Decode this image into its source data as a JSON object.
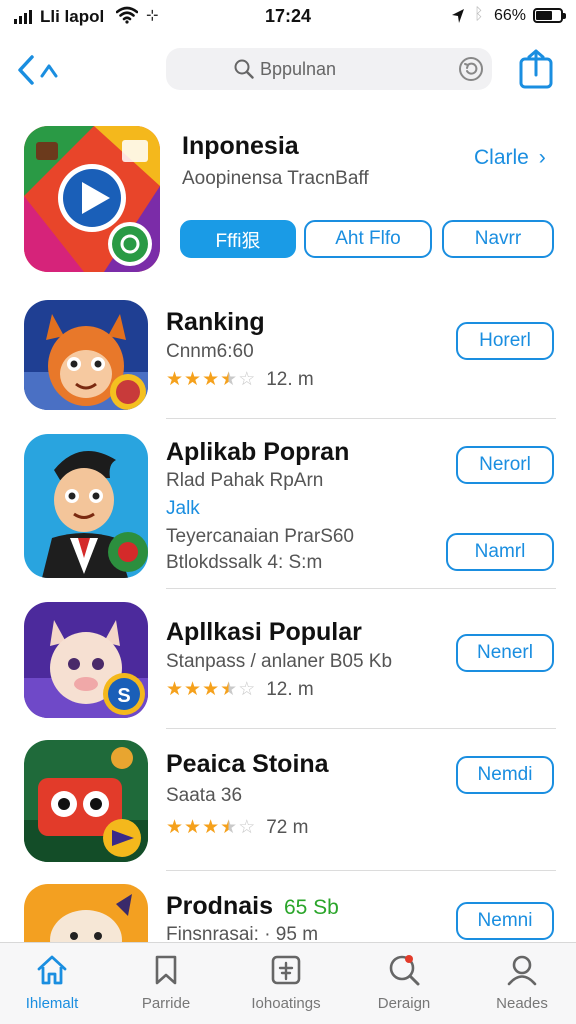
{
  "status_bar": {
    "carrier": "Lli lapol",
    "glyph": "⊹",
    "time": "17:24",
    "battery_pct": "66%",
    "battery_level": 0.66
  },
  "nav": {
    "search_placeholder": "Bppulnan"
  },
  "featured": {
    "title": "Inponesia",
    "subtitle": "Aoopinensa TracnBaff",
    "side_link": "Clarle",
    "buttons": [
      "Fffi狠",
      "Aht Flfo",
      "Navrr"
    ]
  },
  "apps": [
    {
      "title": "Ranking",
      "line1": "Cnnm6:60",
      "rating": 3.5,
      "count": "12. m",
      "button": "Horerl"
    },
    {
      "title": "Aplikab Popran",
      "line1": "Rlad Pahak RpArn",
      "blue": "Jalk",
      "line2": "Teyercanaian PrarS60",
      "line3": "Btlokdssalk 4: S:m",
      "button": "Nerorl",
      "button2": "Namrl"
    },
    {
      "title": "Apllkasi Popular",
      "line1": "Stanpass / anlaner B05 Kb",
      "rating": 3.5,
      "count": "12. m",
      "button": "Nenerl"
    },
    {
      "title": "Peaica Stoina",
      "line1": "Saata 36",
      "rating": 3.5,
      "count": "72 m",
      "button": "Nemdi"
    },
    {
      "title": "Prodnais",
      "title_green": "65 Sb",
      "line1": "Finsnrasai: · 95 m",
      "button": "Nemni"
    }
  ],
  "tabs": [
    {
      "label": "Ihlemalt",
      "icon": "home-icon",
      "active": true
    },
    {
      "label": "Parride",
      "icon": "bookmark-icon",
      "active": false
    },
    {
      "label": "Iohoatings",
      "icon": "grid-icon",
      "active": false
    },
    {
      "label": "Deraign",
      "icon": "search-icon",
      "active": false
    },
    {
      "label": "Neades",
      "icon": "profile-icon",
      "active": false
    }
  ],
  "colors": {
    "accent": "#1a8ee0",
    "star": "#f5a11c",
    "green_tag": "#2aa52a"
  }
}
